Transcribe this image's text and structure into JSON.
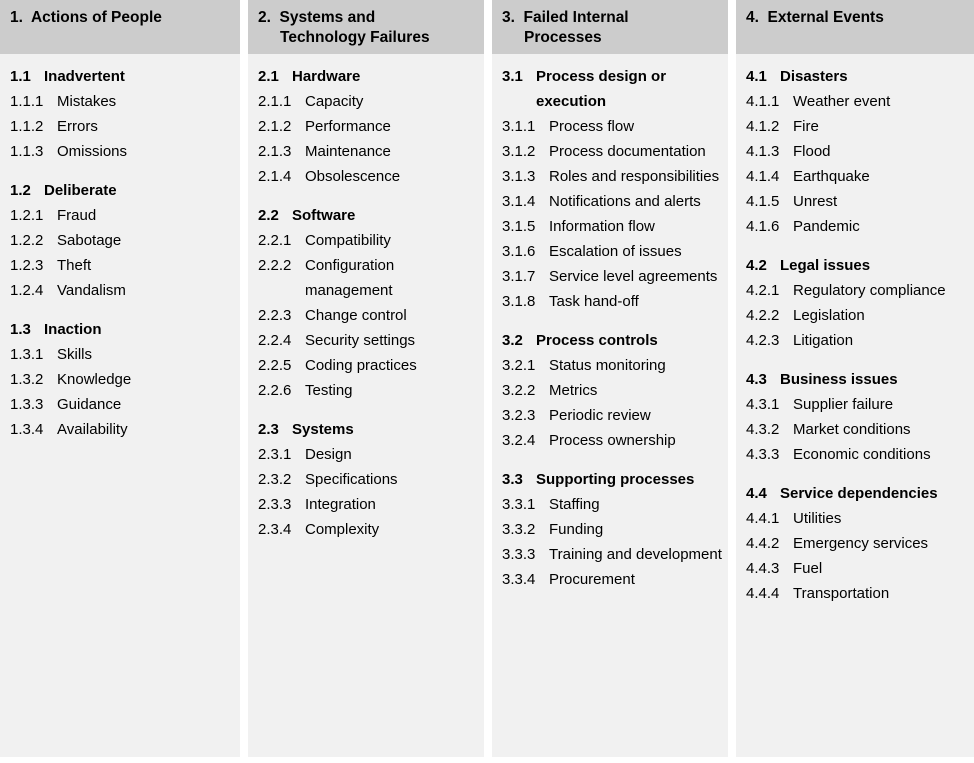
{
  "colors": {
    "header_background": "#cccccc",
    "body_background": "#f1f1f1",
    "page_background": "#ffffff",
    "text": "#000000"
  },
  "columns": [
    {
      "header_lines": [
        "1.  Actions of People"
      ],
      "groups": [
        {
          "number": "1.1",
          "title": "Inadvertent",
          "items": [
            {
              "number": "1.1.1",
              "label": "Mistakes"
            },
            {
              "number": "1.1.2",
              "label": "Errors"
            },
            {
              "number": "1.1.3",
              "label": "Omissions"
            }
          ]
        },
        {
          "number": "1.2",
          "title": "Deliberate",
          "items": [
            {
              "number": "1.2.1",
              "label": "Fraud"
            },
            {
              "number": "1.2.2",
              "label": "Sabotage"
            },
            {
              "number": "1.2.3",
              "label": "Theft"
            },
            {
              "number": "1.2.4",
              "label": "Vandalism"
            }
          ]
        },
        {
          "number": "1.3",
          "title": "Inaction",
          "items": [
            {
              "number": "1.3.1",
              "label": "Skills"
            },
            {
              "number": "1.3.2",
              "label": "Knowledge"
            },
            {
              "number": "1.3.3",
              "label": "Guidance"
            },
            {
              "number": "1.3.4",
              "label": "Availability"
            }
          ]
        }
      ]
    },
    {
      "header_lines": [
        "2.  Systems and",
        "Technology Failures"
      ],
      "groups": [
        {
          "number": "2.1",
          "title": "Hardware",
          "items": [
            {
              "number": "2.1.1",
              "label": "Capacity"
            },
            {
              "number": "2.1.2",
              "label": "Performance"
            },
            {
              "number": "2.1.3",
              "label": "Maintenance"
            },
            {
              "number": "2.1.4",
              "label": "Obsolescence"
            }
          ]
        },
        {
          "number": "2.2",
          "title": "Software",
          "items": [
            {
              "number": "2.2.1",
              "label": "Compatibility"
            },
            {
              "number": "2.2.2",
              "label": "Configuration management"
            },
            {
              "number": "2.2.3",
              "label": "Change control"
            },
            {
              "number": "2.2.4",
              "label": "Security settings"
            },
            {
              "number": "2.2.5",
              "label": "Coding practices"
            },
            {
              "number": "2.2.6",
              "label": "Testing"
            }
          ]
        },
        {
          "number": "2.3",
          "title": "Systems",
          "items": [
            {
              "number": "2.3.1",
              "label": "Design"
            },
            {
              "number": "2.3.2",
              "label": "Specifications"
            },
            {
              "number": "2.3.3",
              "label": "Integration"
            },
            {
              "number": "2.3.4",
              "label": "Complexity"
            }
          ]
        }
      ]
    },
    {
      "header_lines": [
        "3.  Failed Internal",
        "Processes"
      ],
      "groups": [
        {
          "number": "3.1",
          "title": "Process design or execution",
          "items": [
            {
              "number": "3.1.1",
              "label": "Process flow"
            },
            {
              "number": "3.1.2",
              "label": "Process documentation"
            },
            {
              "number": "3.1.3",
              "label": "Roles and responsibilities"
            },
            {
              "number": "3.1.4",
              "label": "Notifications and alerts"
            },
            {
              "number": "3.1.5",
              "label": "Information flow"
            },
            {
              "number": "3.1.6",
              "label": "Escalation of issues"
            },
            {
              "number": "3.1.7",
              "label": "Service level agreements"
            },
            {
              "number": "3.1.8",
              "label": "Task hand-off"
            }
          ]
        },
        {
          "number": "3.2",
          "title": "Process controls",
          "items": [
            {
              "number": "3.2.1",
              "label": "Status monitoring"
            },
            {
              "number": "3.2.2",
              "label": "Metrics"
            },
            {
              "number": "3.2.3",
              "label": "Periodic review"
            },
            {
              "number": "3.2.4",
              "label": "Process ownership"
            }
          ]
        },
        {
          "number": "3.3",
          "title": "Supporting processes",
          "items": [
            {
              "number": "3.3.1",
              "label": "Staffing"
            },
            {
              "number": "3.3.2",
              "label": "Funding"
            },
            {
              "number": "3.3.3",
              "label": "Training and development"
            },
            {
              "number": "3.3.4",
              "label": "Procurement"
            }
          ]
        }
      ]
    },
    {
      "header_lines": [
        "4.  External Events"
      ],
      "groups": [
        {
          "number": "4.1",
          "title": "Disasters",
          "items": [
            {
              "number": "4.1.1",
              "label": "Weather event"
            },
            {
              "number": "4.1.2",
              "label": "Fire"
            },
            {
              "number": "4.1.3",
              "label": "Flood"
            },
            {
              "number": "4.1.4",
              "label": "Earthquake"
            },
            {
              "number": "4.1.5",
              "label": "Unrest"
            },
            {
              "number": "4.1.6",
              "label": "Pandemic"
            }
          ]
        },
        {
          "number": "4.2",
          "title": "Legal issues",
          "items": [
            {
              "number": "4.2.1",
              "label": "Regulatory com­pliance"
            },
            {
              "number": "4.2.2",
              "label": "Legislation"
            },
            {
              "number": "4.2.3",
              "label": "Litigation"
            }
          ]
        },
        {
          "number": "4.3",
          "title": "Business issues",
          "items": [
            {
              "number": "4.3.1",
              "label": "Supplier failure"
            },
            {
              "number": "4.3.2",
              "label": "Market conditions"
            },
            {
              "number": "4.3.3",
              "label": "Economic conditions"
            }
          ]
        },
        {
          "number": "4.4",
          "title": "Service dependencies",
          "items": [
            {
              "number": "4.4.1",
              "label": "Utilities"
            },
            {
              "number": "4.4.2",
              "label": "Emergency services"
            },
            {
              "number": "4.4.3",
              "label": "Fuel"
            },
            {
              "number": "4.4.4",
              "label": "Transportation"
            }
          ]
        }
      ]
    }
  ]
}
